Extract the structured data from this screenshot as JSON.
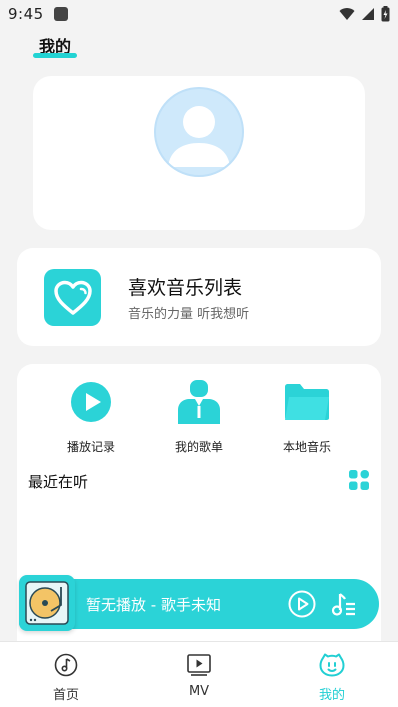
{
  "status_bar": {
    "time": "9:45"
  },
  "header": {
    "title": "我的"
  },
  "favorites": {
    "title": "喜欢音乐列表",
    "subtitle": "音乐的力量 听我想听"
  },
  "quick_actions": [
    {
      "label": "播放记录",
      "icon": "play-circle-icon"
    },
    {
      "label": "我的歌单",
      "icon": "user-suit-icon"
    },
    {
      "label": "本地音乐",
      "icon": "folder-icon"
    }
  ],
  "recent": {
    "title": "最近在听"
  },
  "player": {
    "now_playing": "暂无播放 - 歌手未知"
  },
  "bottom_nav": [
    {
      "label": "首页",
      "icon": "music-note-icon"
    },
    {
      "label": "MV",
      "icon": "video-play-icon"
    },
    {
      "label": "我的",
      "icon": "smile-face-icon",
      "active": true
    }
  ],
  "colors": {
    "accent": "#2bd3d7",
    "background": "#f3f3f3",
    "card": "#ffffff"
  }
}
